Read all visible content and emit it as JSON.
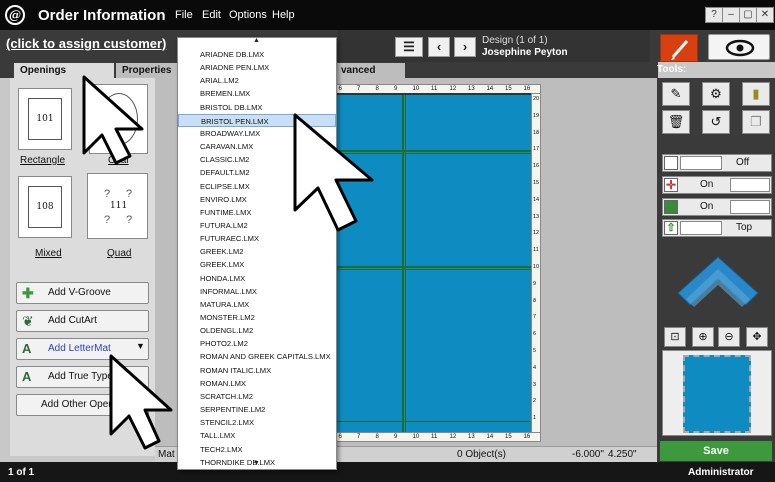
{
  "titlebar": {
    "app_title": "Order Information",
    "menu": [
      "File",
      "Edit",
      "Options",
      "Help"
    ],
    "window_buttons": [
      "?",
      "–",
      "▢",
      "✕"
    ]
  },
  "header": {
    "customer_link": "(click to assign customer)",
    "design_label": "Design  (1 of 1)",
    "design_name": "Josephine Peyton",
    "menu_glyph": "☰",
    "prev_glyph": "‹",
    "next_glyph": "›"
  },
  "tabs": {
    "openings": "Openings",
    "properties": "Properties",
    "advanced": "vanced",
    "tools_label": "Tools:"
  },
  "openings": {
    "rectangle_label": "Rectangle",
    "rectangle_value": "101",
    "oval_label": "Oval",
    "mixed_label": "Mixed",
    "mixed_value": "108",
    "quad_label": "Quad",
    "quad_value": "111",
    "quad_glyph": "?"
  },
  "buttons": {
    "add_vgroove": "Add V-Groove",
    "add_cutart": "Add CutArt",
    "add_lettermat": "Add LetterMat",
    "add_truetype": "Add True Type",
    "add_other": "Add Other Openi"
  },
  "fonts_dropdown": {
    "selected": "BRISTOL PEN.LMX",
    "items": [
      "ARIADNE DB.LMX",
      "ARIADNE PEN.LMX",
      "ARIAL.LM2",
      "BREMEN.LMX",
      "BRISTOL DB.LMX",
      "BRISTOL PEN.LMX",
      "BROADWAY.LMX",
      "CARAVAN.LMX",
      "CLASSIC.LM2",
      "DEFAULT.LM2",
      "ECLIPSE.LMX",
      "ENVIRO.LMX",
      "FUNTIME.LMX",
      "FUTURA.LM2",
      "FUTURAEC.LMX",
      "GREEK.LM2",
      "GREEK.LMX",
      "HONDA.LMX",
      "INFORMAL.LMX",
      "MATURA.LMX",
      "MONSTER.LM2",
      "OLDENGL.LM2",
      "PHOTO2.LM2",
      "ROMAN AND GREEK CAPITALS.LMX",
      "ROMAN ITALIC.LMX",
      "ROMAN.LMX",
      "SCRATCH.LM2",
      "SERPENTINE.LM2",
      "STENCIL2.LMX",
      "TALL.LMX",
      "TECH2.LMX",
      "THORNDIKE DB.LMX"
    ]
  },
  "canvas": {
    "ruler_top": [
      "5",
      "6",
      "7",
      "8",
      "9",
      "10",
      "11",
      "12",
      "13",
      "14",
      "15",
      "16"
    ],
    "ruler_right": [
      "20",
      "19",
      "18",
      "17",
      "16",
      "15",
      "14",
      "13",
      "12",
      "11",
      "10",
      "9",
      "8",
      "7",
      "6",
      "5",
      "4",
      "3",
      "2",
      "1"
    ],
    "mat_color": "#0e8cc1"
  },
  "status": {
    "mat_label": "Mat",
    "objects": "0 Object(s)",
    "coord_x": "-6.000\"",
    "coord_y": "4.250\""
  },
  "tools": {
    "toggle1": "Off",
    "toggle2": "On",
    "toggle3": "On",
    "toggle4": "Top",
    "save": "Save"
  },
  "footer": {
    "page": "1 of 1",
    "user": "Administrator"
  }
}
